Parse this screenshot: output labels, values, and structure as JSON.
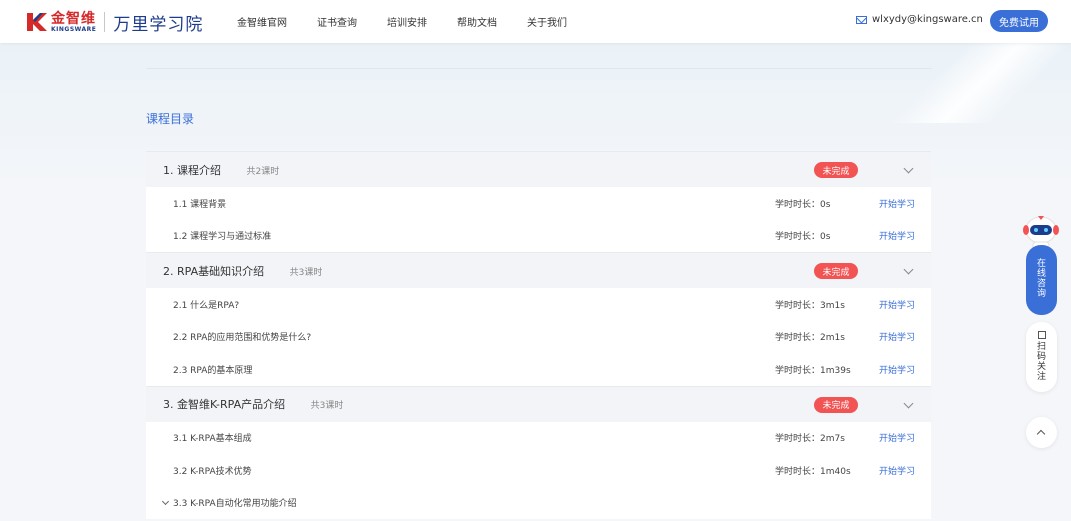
{
  "header": {
    "logo_cn": "金智维",
    "logo_en": "KINGSWARE",
    "school": "万里学习院",
    "nav": [
      "金智维官网",
      "证书查询",
      "培训安排",
      "帮助文档",
      "关于我们"
    ],
    "email": "wlxydy@kingsware.cn",
    "trial_label": "免费试用"
  },
  "catalog": {
    "title": "课程目录",
    "chapters": [
      {
        "title": "1. 课程介绍",
        "count": "共2课时",
        "status": "未完成",
        "lessons": [
          {
            "title": "1.1 课程背景",
            "duration": "学时时长：0s",
            "action": "开始学习"
          },
          {
            "title": "1.2 课程学习与通过标准",
            "duration": "学时时长：0s",
            "action": "开始学习"
          }
        ]
      },
      {
        "title": "2. RPA基础知识介绍",
        "count": "共3课时",
        "status": "未完成",
        "lessons": [
          {
            "title": "2.1 什么是RPA?",
            "duration": "学时时长：3m1s",
            "action": "开始学习"
          },
          {
            "title": "2.2 RPA的应用范围和优势是什么?",
            "duration": "学时时长：2m1s",
            "action": "开始学习"
          },
          {
            "title": "2.3 RPA的基本原理",
            "duration": "学时时长：1m39s",
            "action": "开始学习"
          }
        ]
      },
      {
        "title": "3. 金智维K-RPA产品介绍",
        "count": "共3课时",
        "status": "未完成",
        "lessons": [
          {
            "title": "3.1 K-RPA基本组成",
            "duration": "学时时长：2m7s",
            "action": "开始学习"
          },
          {
            "title": "3.2 K-RPA技术优势",
            "duration": "学时时长：1m40s",
            "action": "开始学习"
          },
          {
            "title": "3.3 K-RPA自动化常用功能介绍"
          }
        ]
      }
    ]
  },
  "float": {
    "consult_chars": [
      "在",
      "线",
      "咨",
      "询"
    ],
    "scan_chars": [
      "扫",
      "码",
      "关",
      "注"
    ]
  },
  "colors": {
    "accent": "#3a6fd8",
    "badge": "#f25353",
    "brand_red": "#d62a2a",
    "brand_blue": "#1e3c8c"
  }
}
